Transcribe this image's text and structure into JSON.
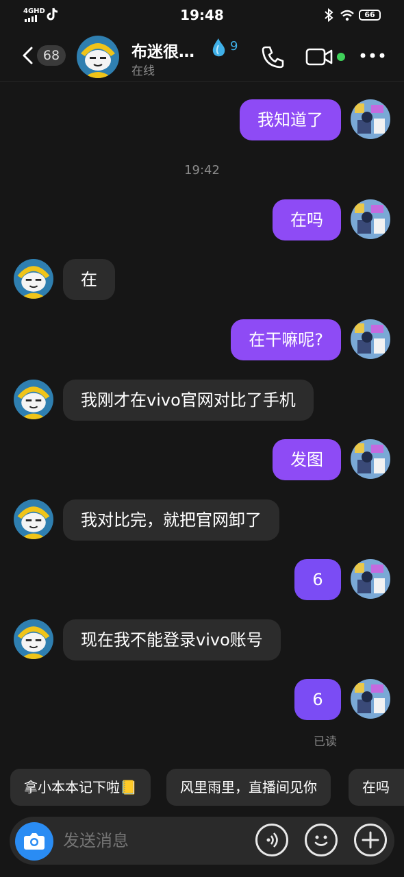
{
  "status_bar": {
    "time": "19:48",
    "network": "4GHD",
    "battery": "66",
    "icons": [
      "signal-icon",
      "tiktok-icon",
      "bluetooth-icon",
      "wifi-icon",
      "battery-icon"
    ]
  },
  "header": {
    "back_badge": "68",
    "contact_name": "布迷很…",
    "status": "在线",
    "streak_count": "9",
    "online_color": "#3fd15a"
  },
  "messages": [
    {
      "from": "me",
      "text": "我知道了"
    },
    {
      "type": "timestamp",
      "text": "19:42"
    },
    {
      "from": "me",
      "text": "在吗"
    },
    {
      "from": "them",
      "text": "在"
    },
    {
      "from": "me",
      "text": "在干嘛呢?"
    },
    {
      "from": "them",
      "text": "我刚才在vivo官网对比了手机"
    },
    {
      "from": "me",
      "text": "发图"
    },
    {
      "from": "them",
      "text": "我对比完，就把官网卸了"
    },
    {
      "from": "me",
      "text": "6"
    },
    {
      "from": "them",
      "text": "现在我不能登录vivo账号"
    },
    {
      "from": "me",
      "text": "6"
    }
  ],
  "read_receipt": "已读",
  "quick_replies": [
    "拿小本本记下啦📒",
    "风里雨里，直播间见你",
    "在吗"
  ],
  "input": {
    "placeholder": "发送消息"
  },
  "colors": {
    "background": "#161616",
    "sent_bubble": "#8e4bf5",
    "received_bubble": "#2c2c2c",
    "camera_button": "#2a8cf3"
  }
}
